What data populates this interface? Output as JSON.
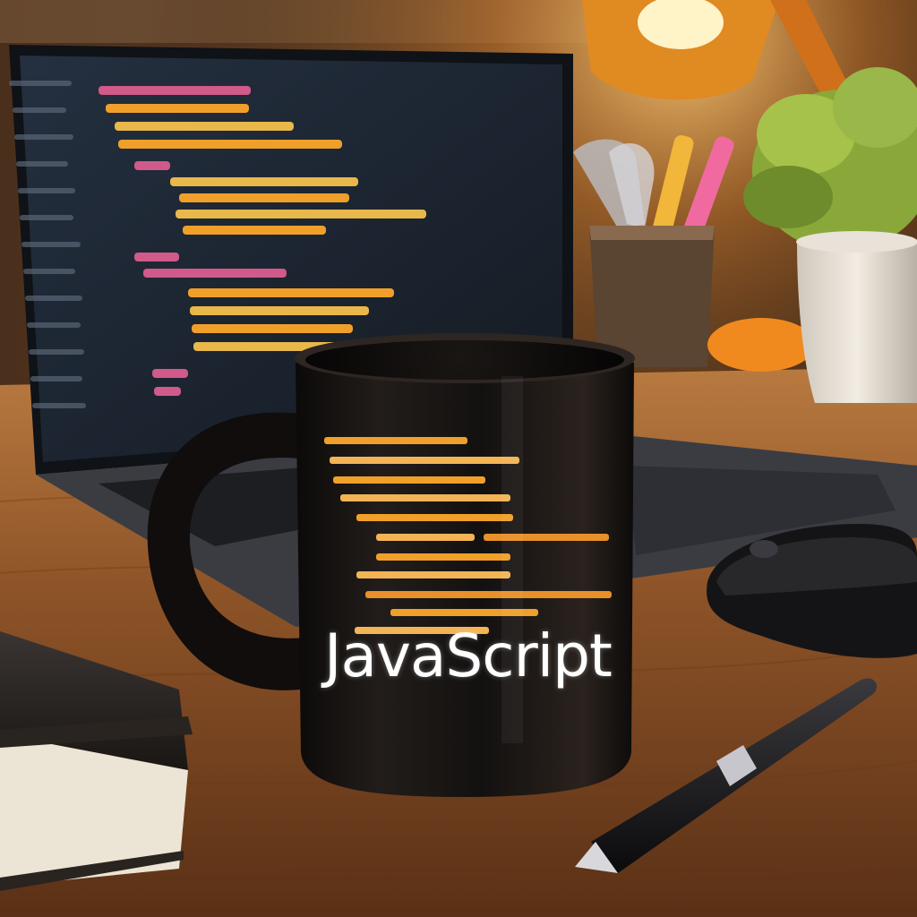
{
  "scene": {
    "mug_text": "JavaScript",
    "colors": {
      "wall_dark": "#3a2414",
      "lamp_glow": "#ffb040",
      "desk_wood": "#8a5228",
      "mug_black": "#141110",
      "code_orange": "#f0a02a",
      "code_pink": "#d05a8a",
      "screen_bg": "#1e2733",
      "plant_green": "#8aa83a"
    },
    "icons": [
      "laptop",
      "coffee-mug",
      "desk-lamp",
      "pen-holder",
      "potted-plant",
      "computer-mouse",
      "notebook",
      "pen"
    ]
  }
}
